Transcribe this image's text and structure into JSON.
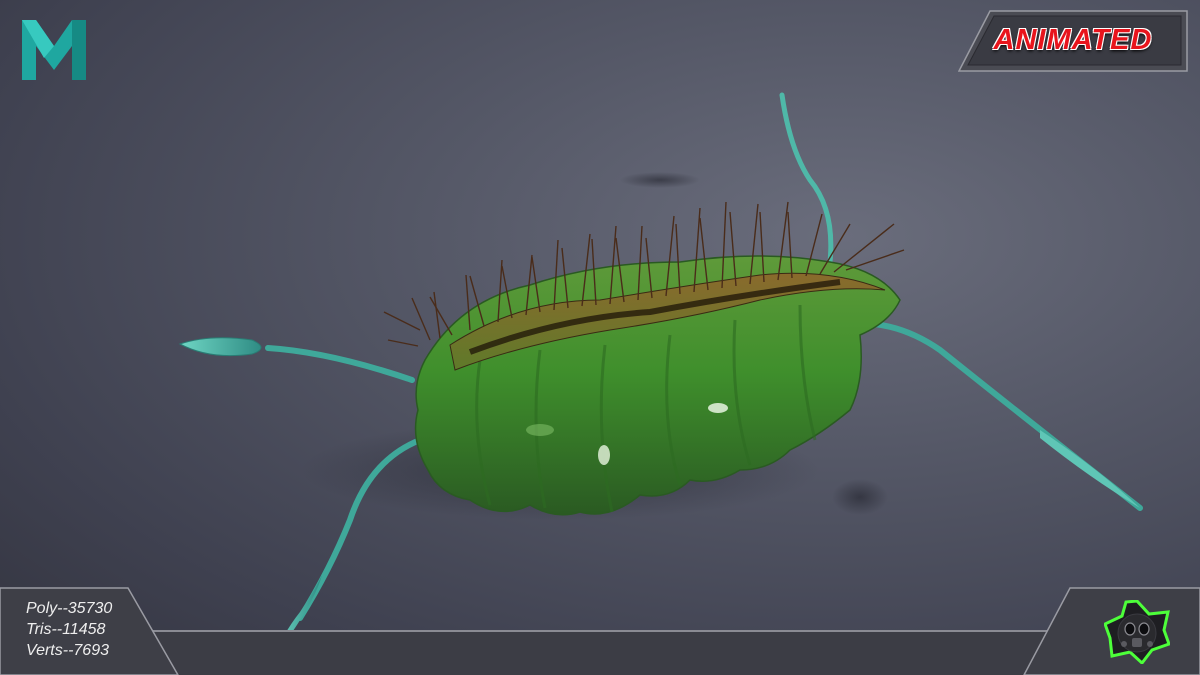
{
  "app": {
    "logo_icon": "maya-logo-icon"
  },
  "badge": {
    "label": "ANIMATED",
    "color": "#e8141c"
  },
  "stats": {
    "poly": "Poly--35730",
    "tris": "Tris--11458",
    "verts": "Verts--7693"
  },
  "emblem": {
    "icon": "gas-mask-icon",
    "glow_color": "#4dff3a"
  },
  "colors": {
    "model_green": "#3f8f2c",
    "tendril_teal": "#4fb8a8",
    "hair_brown": "#4a2c1a"
  }
}
